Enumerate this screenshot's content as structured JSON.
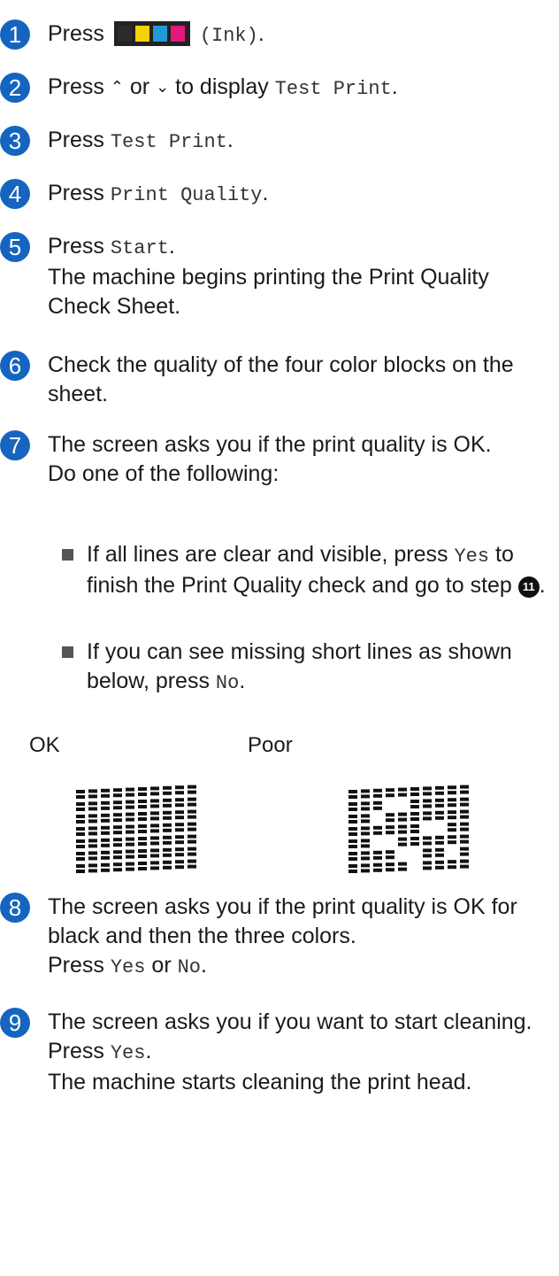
{
  "colors": {
    "step_badge": "#1565c0",
    "ink_k": "#2b2b2b",
    "ink_y": "#f5d200",
    "ink_c": "#1f9ad6",
    "ink_m": "#e0197a"
  },
  "steps": [
    {
      "num": "1",
      "pre": "Press",
      "icon": "ink-cartridges-icon",
      "mono": "(Ink)",
      "post": "."
    },
    {
      "num": "2",
      "pre": "Press",
      "up": "^",
      "mid": "or",
      "down": "v",
      "post1": "to display",
      "mono": "Test Print",
      "post": "."
    },
    {
      "num": "3",
      "pre": "Press",
      "mono": "Test Print",
      "post": "."
    },
    {
      "num": "4",
      "pre": "Press",
      "mono": "Print Quality",
      "post": "."
    },
    {
      "num": "5",
      "pre": "Press",
      "mono": "Start",
      "post": ".",
      "line2": "The machine begins printing the Print Quality Check Sheet."
    },
    {
      "num": "6",
      "text": "Check the quality of the four color blocks on the sheet."
    },
    {
      "num": "7",
      "text": "The screen asks you if the print quality is OK.",
      "line2": "Do one of the following:",
      "bullets": [
        {
          "pre": "If all lines are clear and visible, press",
          "mono": "Yes",
          "post": "to finish the Print Quality check and go to step",
          "ref": "11",
          "end": "."
        },
        {
          "pre": "If you can see missing short lines as shown below, press",
          "mono": "No",
          "end": "."
        }
      ]
    },
    {
      "num": "8",
      "text": "The screen asks you if the print quality is OK for black and then the three colors.",
      "pre": "Press",
      "mono1": "Yes",
      "mid": "or",
      "mono2": "No",
      "post": "."
    },
    {
      "num": "9",
      "text": "The screen asks you if you want to start cleaning.",
      "pre": "Press",
      "mono": "Yes",
      "post": ".",
      "line3": "The machine starts cleaning the print head."
    }
  ],
  "samples": {
    "ok_label": "OK",
    "poor_label": "Poor",
    "ok_pattern": {
      "rows": 7,
      "cols": 10,
      "missing": []
    },
    "poor_pattern": {
      "rows": 7,
      "cols": 10,
      "missing": [
        [
          1,
          3
        ],
        [
          1,
          4
        ],
        [
          2,
          2
        ],
        [
          3,
          6
        ],
        [
          3,
          7
        ],
        [
          4,
          2
        ],
        [
          4,
          3
        ],
        [
          5,
          4
        ],
        [
          5,
          5
        ],
        [
          5,
          8
        ],
        [
          6,
          5
        ]
      ]
    }
  }
}
